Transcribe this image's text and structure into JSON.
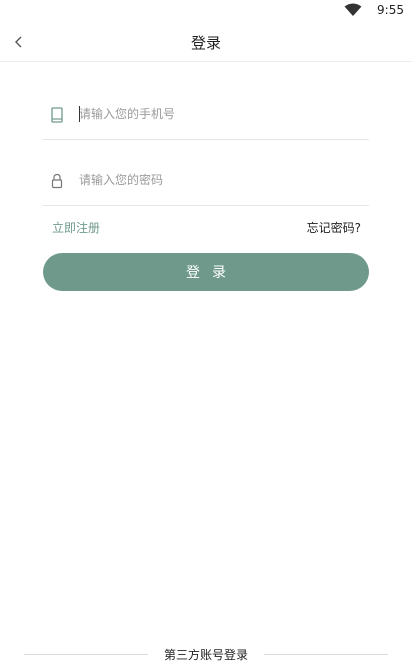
{
  "status_bar": {
    "time": "9:55",
    "wifi_icon": "wifi-icon"
  },
  "app_bar": {
    "title": "登录",
    "back_icon": "chevron-left-icon"
  },
  "form": {
    "phone": {
      "placeholder": "请输入您的手机号",
      "value": "",
      "icon": "phone-icon"
    },
    "password": {
      "placeholder": "请输入您的密码",
      "value": "",
      "icon": "lock-icon"
    }
  },
  "links": {
    "register": "立即注册",
    "forgot": "忘记密码?"
  },
  "login_button": {
    "label": "登录"
  },
  "third_party": {
    "label": "第三方账号登录"
  },
  "colors": {
    "accent": "#6f9a8b",
    "text": "#222222",
    "placeholder": "#9a9a9a",
    "divider": "#e6e6e6"
  }
}
